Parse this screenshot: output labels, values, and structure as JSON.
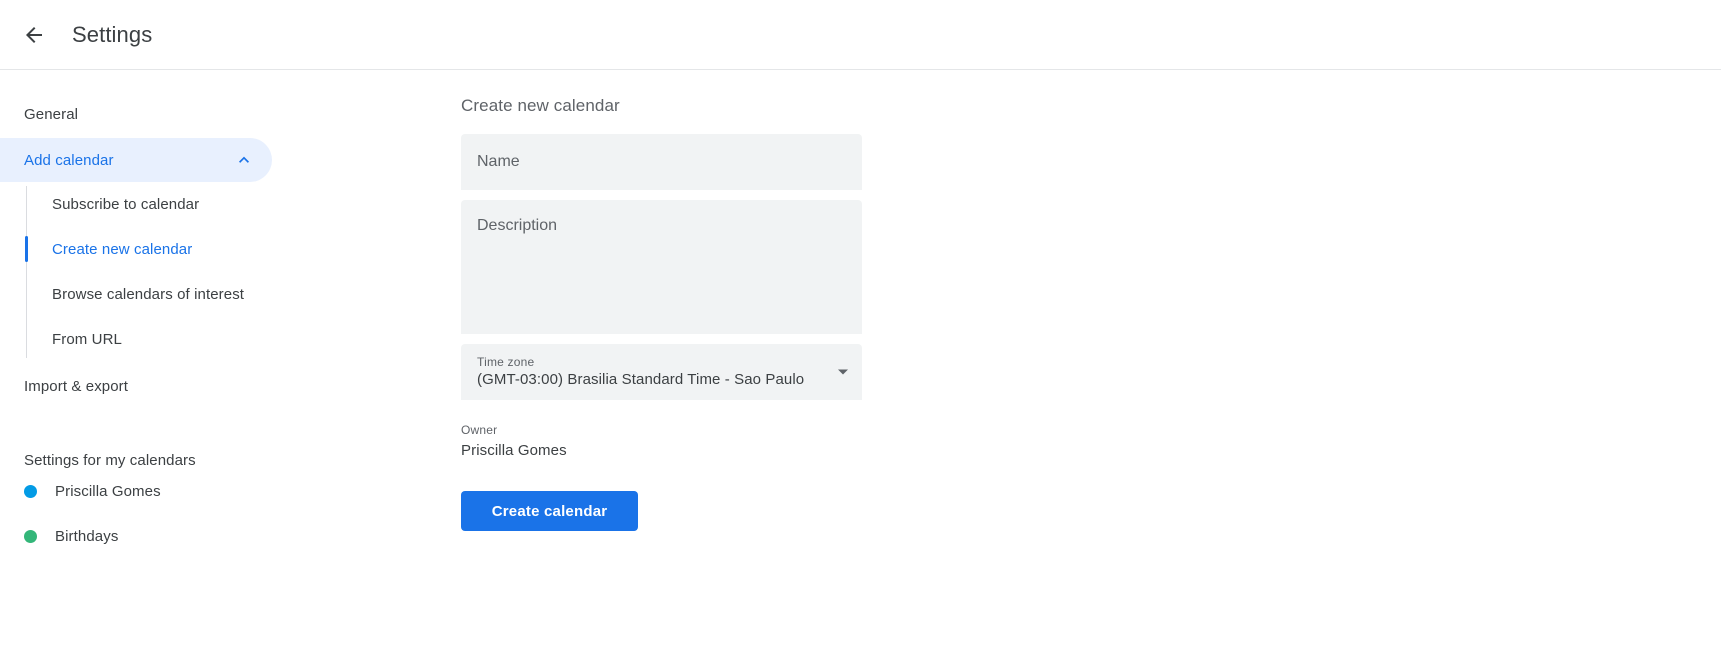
{
  "header": {
    "title": "Settings",
    "back_icon": "arrow-left-icon"
  },
  "sidebar": {
    "general_label": "General",
    "add_calendar": {
      "label": "Add calendar",
      "chevron_icon": "chevron-up-icon",
      "expanded": true,
      "items": [
        {
          "label": "Subscribe to calendar",
          "selected": false
        },
        {
          "label": "Create new calendar",
          "selected": true
        },
        {
          "label": "Browse calendars of interest",
          "selected": false
        },
        {
          "label": "From URL",
          "selected": false
        }
      ]
    },
    "import_export_label": "Import & export",
    "my_calendars": {
      "section_title": "Settings for my calendars",
      "calendars": [
        {
          "name": "Priscilla Gomes",
          "color": "#039be5"
        },
        {
          "name": "Birthdays",
          "color": "#33b679"
        }
      ]
    }
  },
  "main": {
    "heading": "Create new calendar",
    "name_field": {
      "placeholder": "Name",
      "value": ""
    },
    "description_field": {
      "placeholder": "Description",
      "value": ""
    },
    "time_zone": {
      "label": "Time zone",
      "value": "(GMT-03:00) Brasilia Standard Time - Sao Paulo",
      "caret_icon": "dropdown-caret-icon"
    },
    "owner": {
      "label": "Owner",
      "value": "Priscilla Gomes"
    },
    "create_button": {
      "label": "Create calendar",
      "color": "#1a73e8"
    }
  }
}
